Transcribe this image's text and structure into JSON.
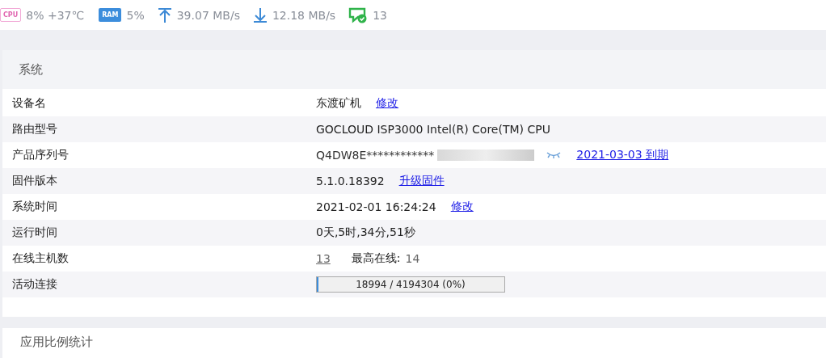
{
  "status_bar": {
    "cpu": {
      "icon": "CPU",
      "reading": "8% +37℃"
    },
    "ram": {
      "icon": "RAM",
      "reading": "5%"
    },
    "upload": "39.07 MB/s",
    "download": "12.18 MB/s",
    "hosts": "13"
  },
  "system_panel": {
    "title": "系统",
    "rows": [
      {
        "kind": "text",
        "label": "设备名",
        "value": "东渡矿机",
        "link": "修改"
      },
      {
        "kind": "text",
        "label": "路由型号",
        "value": "GOCLOUD ISP3000 Intel(R) Core(TM) CPU"
      },
      {
        "kind": "masked",
        "label": "产品序列号",
        "value": "Q4DW8E************",
        "link": "2021-03-03 到期"
      },
      {
        "kind": "text",
        "label": "固件版本",
        "value": "5.1.0.18392",
        "link": "升级固件"
      },
      {
        "kind": "text",
        "label": "系统时间",
        "value": "2021-02-01 16:24:24",
        "link": "修改"
      },
      {
        "kind": "text",
        "label": "运行时间",
        "value": "0天,5时,34分,51秒"
      },
      {
        "kind": "hosts",
        "label": "在线主机数",
        "value": "13",
        "max_label": "最高在线:",
        "max": "14"
      },
      {
        "kind": "progress",
        "label": "活动连接",
        "value": "18994 / 4194304 (0%)",
        "level": 0
      }
    ]
  },
  "app_stats_panel": {
    "title": "应用比例统计"
  }
}
